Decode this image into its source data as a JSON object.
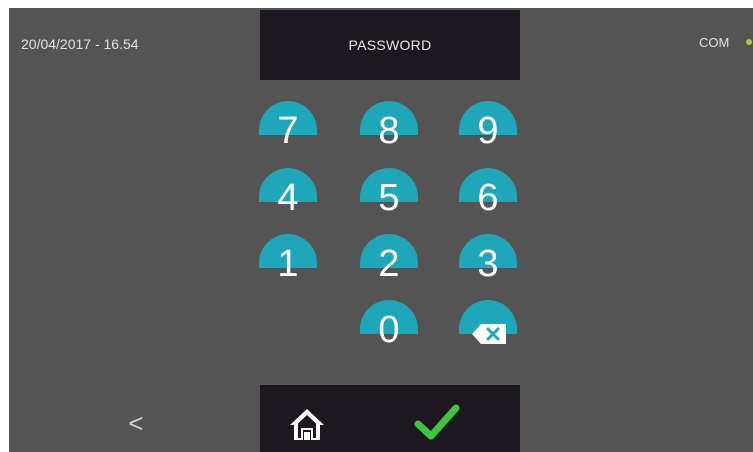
{
  "header": {
    "datetime": "20/04/2017 - 16.54",
    "title": "PASSWORD",
    "com_label": "COM",
    "com_status_color": "#b6c43a"
  },
  "keypad": {
    "accent_color": "#1ea7b8",
    "keys": [
      {
        "label": "7"
      },
      {
        "label": "8"
      },
      {
        "label": "9"
      },
      {
        "label": "4"
      },
      {
        "label": "5"
      },
      {
        "label": "6"
      },
      {
        "label": "1"
      },
      {
        "label": "2"
      },
      {
        "label": "3"
      },
      {
        "label": "0"
      }
    ],
    "backspace_icon": "backspace-icon"
  },
  "footer": {
    "back_label": "<",
    "home_icon": "home-icon",
    "confirm_icon": "checkmark-icon",
    "confirm_color": "#3ec63e"
  }
}
